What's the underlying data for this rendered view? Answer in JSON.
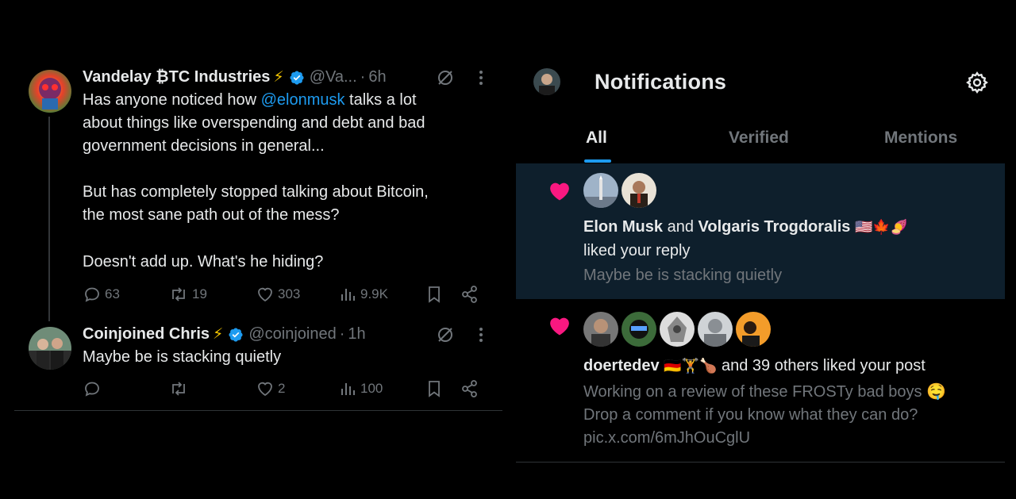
{
  "thread": {
    "post": {
      "name": "Vandelay ₿TC Industries",
      "bolt": "⚡",
      "handle": "@Va...",
      "dot": "·",
      "time": "6h",
      "text_line1_prefix": "Has anyone noticed how ",
      "text_line1_mention": "@elonmusk",
      "text_line1_suffix": " talks a lot",
      "text_line2": "about things like overspending and debt and bad",
      "text_line3": "government decisions in general...",
      "text_line4": "But has completely stopped talking about Bitcoin,",
      "text_line5": "the most sane path out of the mess?",
      "text_line6": "Doesn't add up. What's he hiding?",
      "replies": "63",
      "reposts": "19",
      "likes": "303",
      "views": "9.9K"
    },
    "reply": {
      "name": "Coinjoined Chris",
      "bolt": "⚡",
      "handle": "@coinjoined",
      "dot": "·",
      "time": "1h",
      "text": "Maybe be is stacking quietly",
      "likes": "2",
      "views": "100"
    }
  },
  "notifications": {
    "title": "Notifications",
    "tabs": [
      "All",
      "Verified",
      "Mentions"
    ],
    "active_tab": "All",
    "items": [
      {
        "user1": "Elon Musk",
        "joiner": "and",
        "user2": "Volgaris Trogdoralis",
        "user2_emojis": "🇺🇸🍁🍠",
        "action": "liked your reply",
        "snippet": "Maybe be is stacking quietly"
      },
      {
        "user1": "doertedev",
        "user1_emojis": "🇩🇪🏋🍗",
        "action": "and 39 others liked your post",
        "snippet_line1": "Working on a review of these FROSTy bad boys 🤤",
        "snippet_line2": "Drop a comment if you know what they can do?",
        "snippet_line3": "pic.x.com/6mJhOuCglU"
      }
    ]
  },
  "colors": {
    "background": "#000000",
    "text": "#e7e9ea",
    "muted": "#71767b",
    "accent": "#1d9bf0",
    "like_pink": "#f91880",
    "highlight_bg": "#0e1f2c",
    "bolt": "#f7c800"
  },
  "icons": [
    "reply-icon",
    "repost-icon",
    "like-icon",
    "views-icon",
    "bookmark-icon",
    "share-icon",
    "grok-icon",
    "more-icon",
    "verified-badge-icon",
    "settings-gear-icon",
    "heart-icon"
  ]
}
